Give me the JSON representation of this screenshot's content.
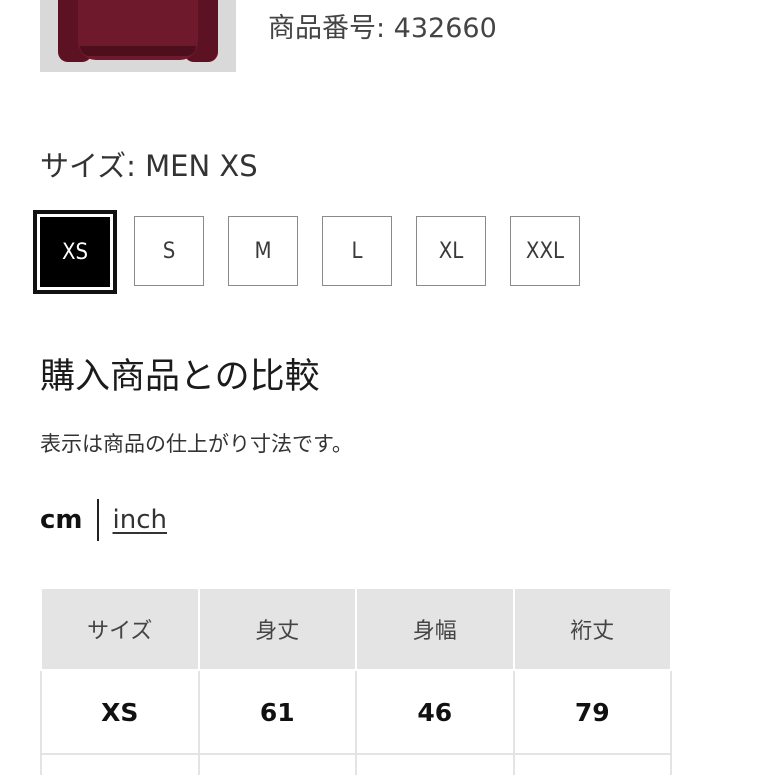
{
  "product": {
    "number_label": "商品番号: 432660",
    "image_color": "#6f1a2c"
  },
  "size_selector": {
    "heading": "サイズ: MEN XS",
    "options": [
      "XS",
      "S",
      "M",
      "L",
      "XL",
      "XXL"
    ],
    "selected": "XS"
  },
  "comparison": {
    "title": "購入商品との比較",
    "note": "表示は商品の仕上がり寸法です。",
    "units": {
      "cm": "cm",
      "inch": "inch",
      "active": "cm"
    }
  },
  "table": {
    "headers": [
      "サイズ",
      "身丈",
      "身幅",
      "裄丈"
    ],
    "rows": [
      [
        "XS",
        "61",
        "46",
        "79"
      ]
    ]
  },
  "colors": {
    "selected_bg": "#000000",
    "header_bg": "#e4e4e4"
  }
}
